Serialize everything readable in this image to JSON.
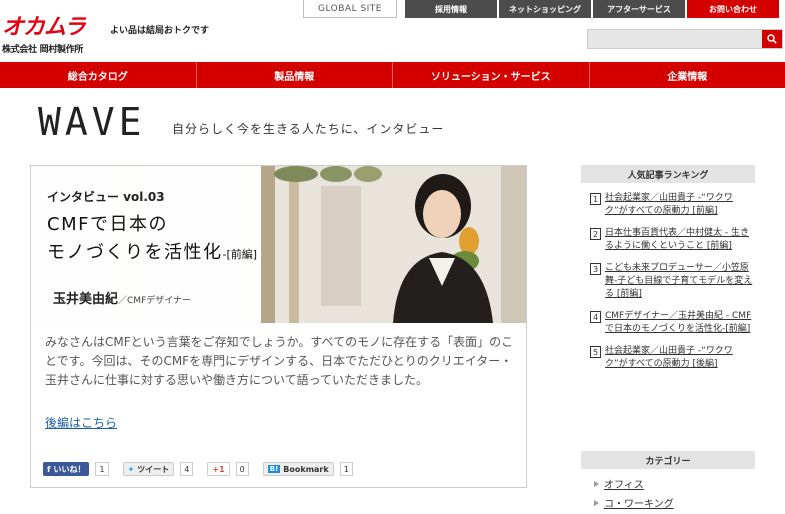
{
  "header": {
    "logo": "オカムラ",
    "company": "株式会社 岡村製作所",
    "tagline": "よい品は結局おトクです",
    "global_site": "GLOBAL SITE",
    "topnav": [
      "採用情報",
      "ネットショッピング",
      "アフターサービス",
      "お問い合わせ"
    ]
  },
  "mainnav": [
    "総合カタログ",
    "製品情報",
    "ソリューション・サービス",
    "企業情報"
  ],
  "page": {
    "title": "WAVE",
    "subtitle": "自分らしく今を生きる人たちに、インタビュー"
  },
  "feature": {
    "vol": "インタビュー vol.03",
    "title_line1": "CMFで日本の",
    "title_line2": "モノづくりを活性化",
    "title_part": "-[前編]",
    "person_name": "玉井美由紀",
    "person_role": "／CMFデザイナー",
    "description": "みなさんはCMFという言葉をご存知でしょうか。すべてのモノに存在する「表面」のことです。今回は、そのCMFを専門にデザインする、日本でただひとりのクリエイター・玉井さんに仕事に対する思いや働き方について語っていただきました。",
    "more_link": "後編はこちら"
  },
  "share": {
    "facebook_label": "いいね！",
    "facebook_count": "1",
    "tweet_label": "ツイート",
    "tweet_count": "4",
    "gplus_label": "+1",
    "gplus_count": "0",
    "hatena_badge": "B!",
    "hatena_label": "Bookmark",
    "hatena_count": "1"
  },
  "sidebar": {
    "ranking_title": "人気記事ランキング",
    "ranking": [
      {
        "num": "1",
        "text": "社会起業家／山田貴子 -“ワクワク”がすべての原動力 [前編]"
      },
      {
        "num": "2",
        "text": "日本仕事百貨代表／中村健太 - 生きるように働くということ [前編]"
      },
      {
        "num": "3",
        "text": "こども未来プロデューサー／小笠原舞-子ども目線で子育てモデルを変える [前編]"
      },
      {
        "num": "4",
        "text": "CMFデザイナー／玉井美由紀 - CMFで日本のモノづくりを活性化-[前編]"
      },
      {
        "num": "5",
        "text": "社会起業家／山田貴子 -“ワクワク”がすべての原動力 [後編]"
      }
    ],
    "category_title": "カテゴリー",
    "categories": [
      "オフィス",
      "コ・ワーキング"
    ]
  }
}
